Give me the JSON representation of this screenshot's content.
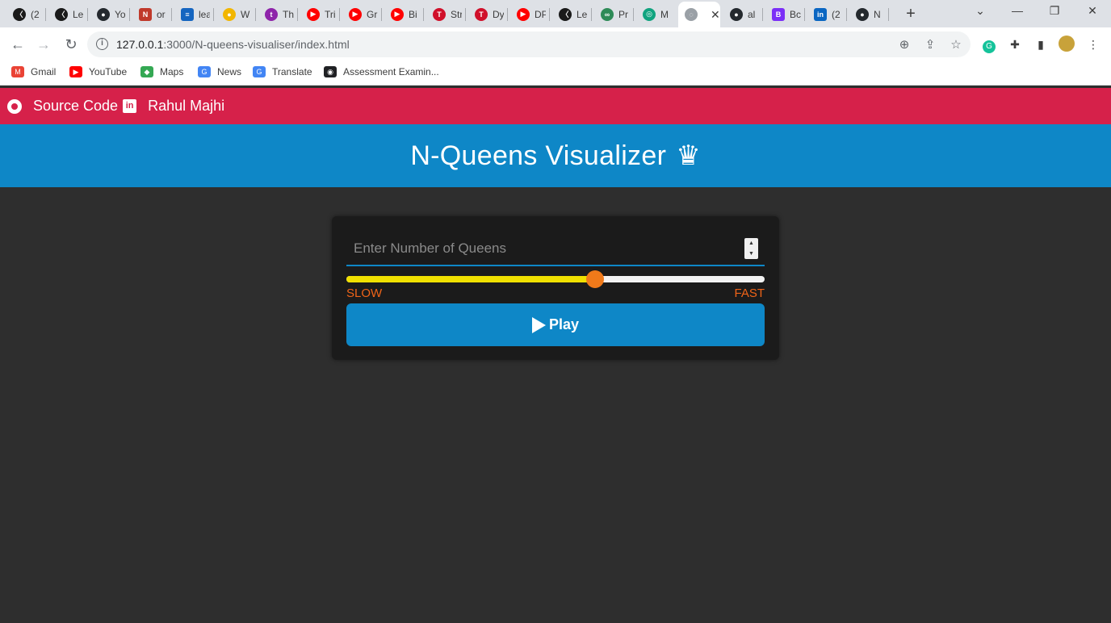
{
  "browser": {
    "tabs": [
      {
        "title": "(2",
        "color": "#1a1a1a",
        "glyph": "〈"
      },
      {
        "title": "Le",
        "color": "#1a1a1a",
        "glyph": "〈"
      },
      {
        "title": "Yo",
        "color": "#24292e",
        "glyph": "●"
      },
      {
        "title": "or",
        "color": "#c0392b",
        "glyph": "N"
      },
      {
        "title": "lea",
        "color": "#1565c0",
        "glyph": "≡"
      },
      {
        "title": "W",
        "color": "#f2b600",
        "glyph": "●"
      },
      {
        "title": "Th",
        "color": "#8e24aa",
        "glyph": "t"
      },
      {
        "title": "Tri",
        "color": "#ff0000",
        "glyph": "▶"
      },
      {
        "title": "Gr",
        "color": "#ff0000",
        "glyph": "▶"
      },
      {
        "title": "Bi",
        "color": "#ff0000",
        "glyph": "▶"
      },
      {
        "title": "Str",
        "color": "#d0102a",
        "glyph": "T"
      },
      {
        "title": "Dy",
        "color": "#d0102a",
        "glyph": "T"
      },
      {
        "title": "DP",
        "color": "#ff0000",
        "glyph": "▶"
      },
      {
        "title": "Le",
        "color": "#1a1a1a",
        "glyph": "〈"
      },
      {
        "title": "Pr",
        "color": "#2e8b57",
        "glyph": "∞"
      },
      {
        "title": "M",
        "color": "#10a37f",
        "glyph": "◎"
      },
      {
        "title": "",
        "color": "#9aa0a6",
        "glyph": "◌",
        "active": true
      },
      {
        "title": "al",
        "color": "#24292e",
        "glyph": "●"
      },
      {
        "title": "Bc",
        "color": "#7b2ff7",
        "glyph": "B"
      },
      {
        "title": "(2",
        "color": "#0a66c2",
        "glyph": "in"
      },
      {
        "title": "N",
        "color": "#24292e",
        "glyph": "●"
      }
    ],
    "url_host": "127.0.0.1",
    "url_path": ":3000/N-queens-visualiser/index.html",
    "bookmarks": [
      {
        "label": "Gmail",
        "color": "#ea4335",
        "glyph": "M"
      },
      {
        "label": "YouTube",
        "color": "#ff0000",
        "glyph": "▶"
      },
      {
        "label": "Maps",
        "color": "#34a853",
        "glyph": "◆"
      },
      {
        "label": "News",
        "color": "#4285f4",
        "glyph": "G"
      },
      {
        "label": "Translate",
        "color": "#4285f4",
        "glyph": "G"
      },
      {
        "label": "Assessment Examin...",
        "color": "#202124",
        "glyph": "◉"
      }
    ]
  },
  "nav": {
    "source_code": "Source Code",
    "author": "Rahul Majhi"
  },
  "header": {
    "title": "N-Queens Visualizer",
    "crown": "♛"
  },
  "controls": {
    "queens_placeholder": "Enter Number of Queens",
    "speed_fraction": 0.595,
    "slow_label": "SLOW",
    "fast_label": "FAST",
    "play_label": "Play"
  },
  "colors": {
    "nav_bg": "#d6214a",
    "header_bg": "#0e87c7",
    "page_bg": "#2e2e2e",
    "accent_orange": "#f06418",
    "slider_fill": "#f0e000"
  }
}
